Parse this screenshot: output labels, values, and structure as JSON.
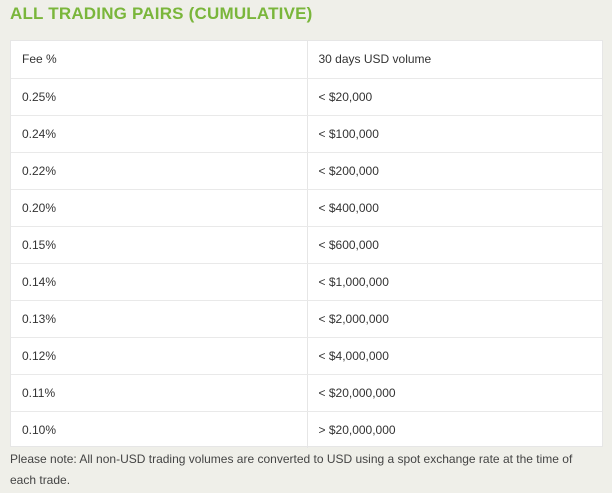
{
  "title": "ALL TRADING PAIRS (CUMULATIVE)",
  "table": {
    "headers": [
      "Fee %",
      "30 days USD volume"
    ],
    "rows": [
      [
        "0.25%",
        "< $20,000"
      ],
      [
        "0.24%",
        "< $100,000"
      ],
      [
        "0.22%",
        "< $200,000"
      ],
      [
        "0.20%",
        "< $400,000"
      ],
      [
        "0.15%",
        "< $600,000"
      ],
      [
        "0.14%",
        "< $1,000,000"
      ],
      [
        "0.13%",
        "< $2,000,000"
      ],
      [
        "0.12%",
        "< $4,000,000"
      ],
      [
        "0.11%",
        "< $20,000,000"
      ],
      [
        "0.10%",
        "> $20,000,000"
      ]
    ]
  },
  "note": "Please note: All non-USD trading volumes are converted to USD using a spot exchange rate at the time of each trade.",
  "colors": {
    "accent": "#7ab63b",
    "background": "#efefe9",
    "table_background": "#ffffff",
    "border": "#e6e6e6"
  }
}
